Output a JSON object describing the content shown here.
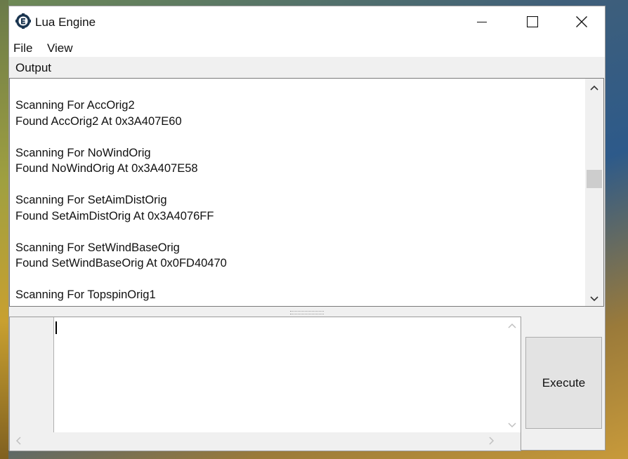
{
  "window": {
    "title": "Lua Engine",
    "icon": "cheat-engine-icon"
  },
  "menu": {
    "items": [
      "File",
      "View"
    ]
  },
  "output": {
    "label": "Output",
    "lines": [
      "Scanning For AccOrig2",
      "Found AccOrig2 At 0x3A407E60",
      "",
      "Scanning For NoWindOrig",
      "Found NoWindOrig At 0x3A407E58",
      "",
      "Scanning For SetAimDistOrig",
      "Found SetAimDistOrig At 0x3A4076FF",
      "",
      "Scanning For SetWindBaseOrig",
      "Found SetWindBaseOrig At 0x0FD40470",
      "",
      "Scanning For TopspinOrig1"
    ]
  },
  "editor": {
    "content": ""
  },
  "execute": {
    "label": "Execute"
  },
  "colors": {
    "window_bg": "#f0f0f0",
    "titlebar_bg": "#ffffff",
    "button_bg": "#e3e3e3"
  }
}
